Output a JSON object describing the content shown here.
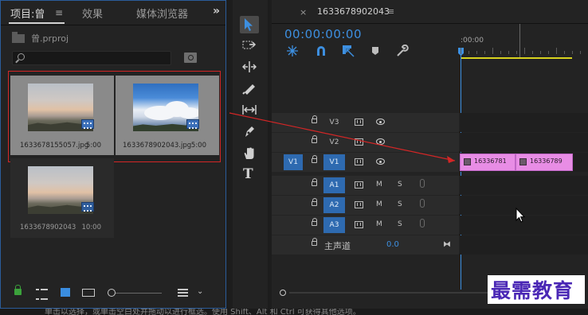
{
  "project_panel": {
    "tabs": [
      {
        "label": "项目:曾"
      },
      {
        "label": "效果"
      },
      {
        "label": "媒体浏览器"
      }
    ],
    "tab_menu": "≡",
    "more": "»",
    "project_file": "曾.prproj",
    "search_placeholder": "",
    "clips": [
      {
        "name": "1633678155057.jpg",
        "duration": "5:00",
        "selected": true
      },
      {
        "name": "1633678902043.jpg",
        "duration": "5:00",
        "selected": true
      },
      {
        "name": "1633678902043",
        "duration": "10:00",
        "selected": false
      }
    ]
  },
  "timeline": {
    "close": "×",
    "sequence_name": "1633678902043",
    "sequence_menu": "≡",
    "timecode": "00:00:00:00",
    "ruler_label": ":00:00",
    "tracks": [
      {
        "name": "V3",
        "type": "video",
        "targeted": false,
        "source": ""
      },
      {
        "name": "V2",
        "type": "video",
        "targeted": false,
        "source": ""
      },
      {
        "name": "V1",
        "type": "video",
        "targeted": true,
        "source": "V1"
      },
      {
        "name": "A1",
        "type": "audio",
        "targeted": true,
        "source": ""
      },
      {
        "name": "A2",
        "type": "audio",
        "targeted": true,
        "source": ""
      },
      {
        "name": "A3",
        "type": "audio",
        "targeted": true,
        "source": ""
      }
    ],
    "audio_mute": "M",
    "audio_solo": "S",
    "master": {
      "label": "主声道",
      "value": "0.0",
      "end_icon": "⧓"
    },
    "clips": [
      {
        "label": "16336781"
      },
      {
        "label": "16336789"
      }
    ]
  },
  "watermark": "最需教育",
  "status_text": "单击以选择，或单击空白处并拖动以进行框选。使用 Shift、Alt 和 Ctrl 可获得其他选项。",
  "colors": {
    "accent": "#3d8fe0",
    "clip": "#e88de5",
    "selection": "#d32626",
    "playhead": "#3d8fe0"
  }
}
